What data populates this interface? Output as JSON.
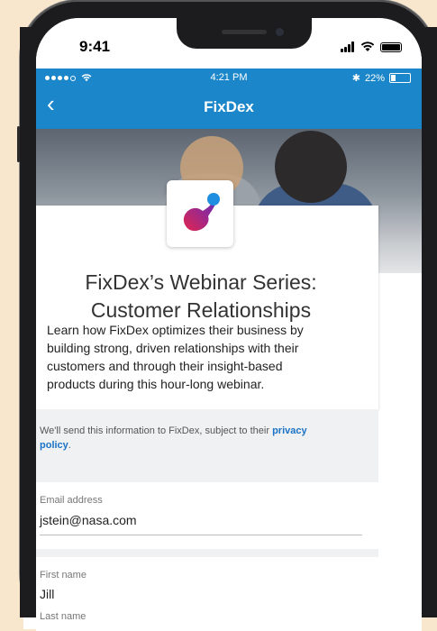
{
  "ios_status": {
    "time": "9:41"
  },
  "app_status": {
    "time": "4:21 PM",
    "battery": "22%"
  },
  "nav": {
    "title": "FixDex",
    "back_icon": "chevron-left-icon"
  },
  "event": {
    "title_line1": "FixDex’s Webinar Series:",
    "title_line2": "Customer Relationships",
    "description_lines": [
      "Learn how FixDex optimizes their business by",
      "building strong, driven relationships with their",
      "customers and through their insight-based",
      "products during this hour-long webinar."
    ]
  },
  "notice": {
    "text": "We'll send this information to FixDex, subject to their ",
    "link": "privacy",
    "link2": "policy",
    "end": "."
  },
  "form": {
    "email": {
      "label": "Email address",
      "value": "jstein@nasa.com"
    },
    "first_name": {
      "label": "First name",
      "value": "Jill"
    },
    "last_name": {
      "label": "Last name"
    }
  },
  "colors": {
    "brand": "#1b86c9",
    "link": "#1b73c6",
    "background": "#f9e7cd"
  }
}
